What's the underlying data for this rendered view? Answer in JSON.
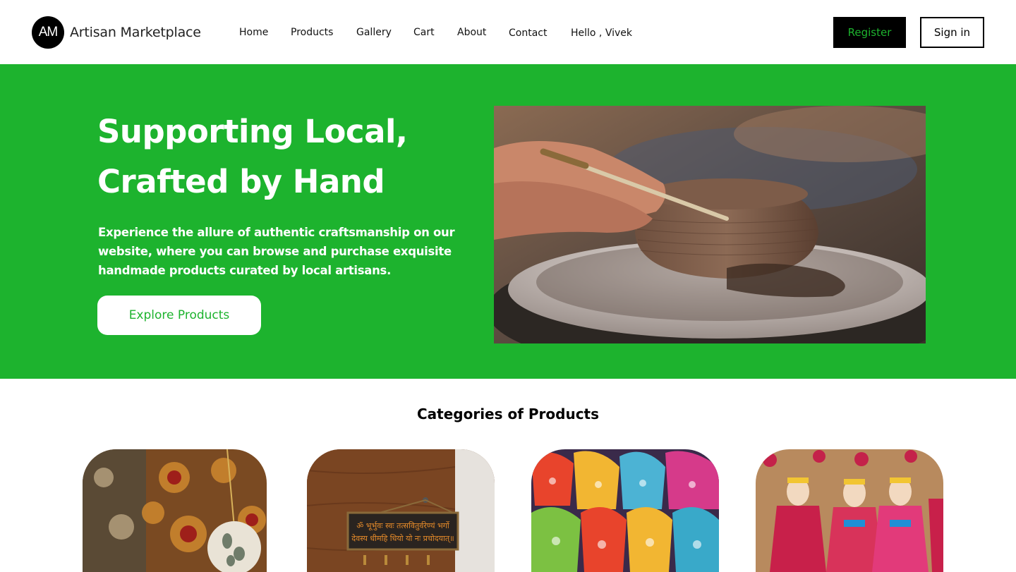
{
  "brand": {
    "logo_initials": "AM",
    "name": "Artisan Marketplace"
  },
  "nav": {
    "items": [
      "Home",
      "Products",
      "Gallery",
      "Cart",
      "About",
      "Contact"
    ],
    "greeting": "Hello , Vivek"
  },
  "auth": {
    "register_label": "Register",
    "signin_label": "Sign in"
  },
  "hero": {
    "title_line1": "Supporting Local,",
    "title_line2": "Crafted by Hand",
    "description": "Experience the allure of authentic craftsmanship on our website, where you can browse and purchase exquisite handmade products curated by local artisans.",
    "cta_label": "Explore Products"
  },
  "categories": {
    "title": "Categories of Products",
    "cards": [
      {
        "image": "block-print-fabric-and-wall-hanging-image"
      },
      {
        "image": "sanskrit-wooden-nameplate-image",
        "sign_text": "ॐ भूर्भुवः स्वः तत्सवितुर्वरेण्यं भर्गो देवस्य धीमहि धियो यो नः प्रचोदयात्॥"
      },
      {
        "image": "embroidered-mojari-shoes-image"
      },
      {
        "image": "rajasthani-puppets-image"
      }
    ]
  },
  "colors": {
    "accent": "#1db32e",
    "dark": "#000000",
    "white": "#ffffff"
  }
}
